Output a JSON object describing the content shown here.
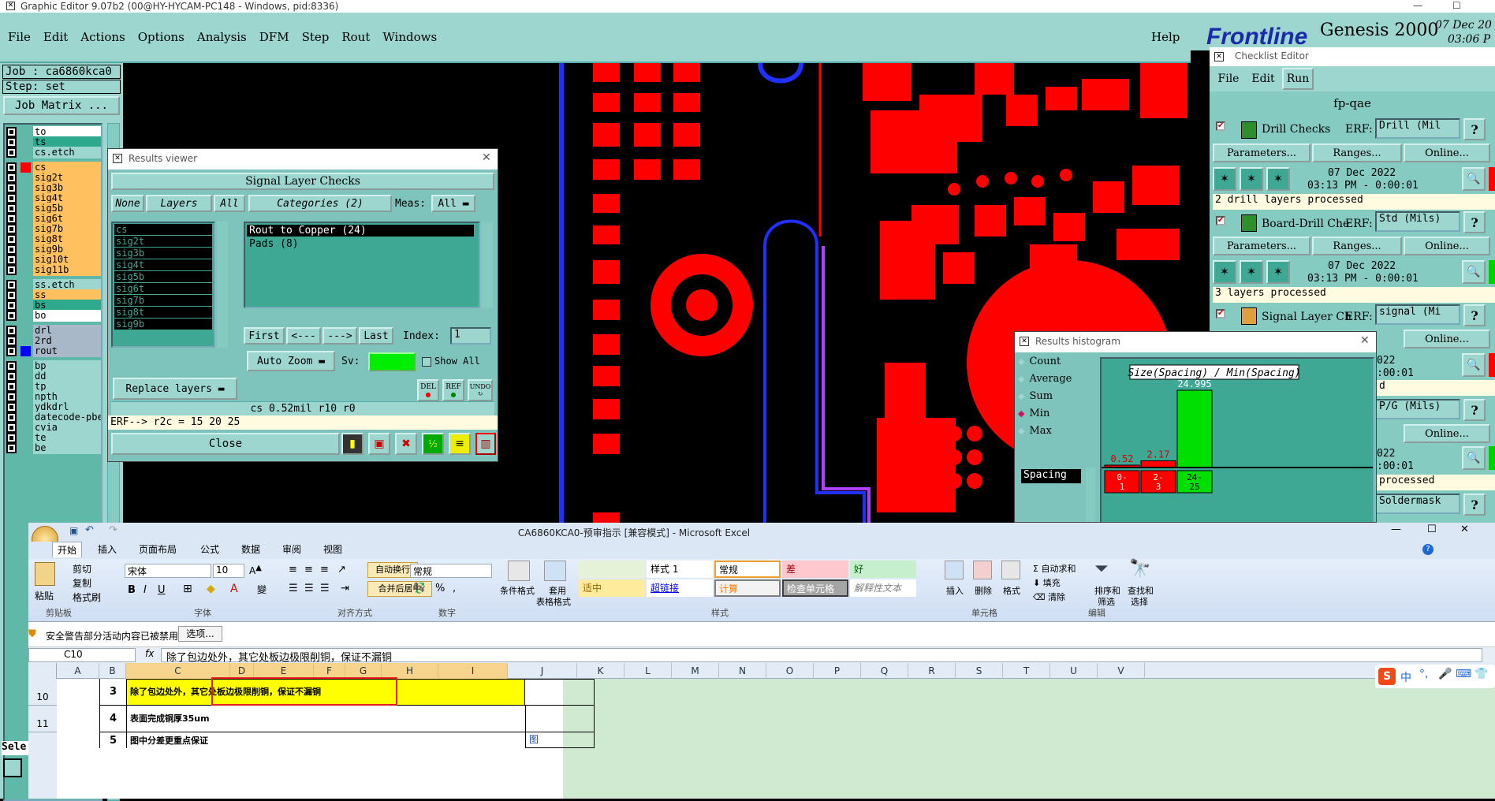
{
  "window_title": "Graphic Editor 9.07b2 (00@HY-HYCAM-PC148 - Windows, pid:8336)",
  "menu": [
    "File",
    "Edit",
    "Actions",
    "Options",
    "Analysis",
    "DFM",
    "Step",
    "Rout",
    "Windows"
  ],
  "menu_help": "Help",
  "brand": {
    "logo": "Frontline",
    "product": "Genesis 2000",
    "date": "07 Dec 20",
    "time": "03:06 P"
  },
  "job": {
    "job_label": "Job : ca6860kca0",
    "step_label": "Step: set",
    "matrix_button": "Job Matrix ..."
  },
  "layers": [
    {
      "name": "to",
      "color": "#ffffff"
    },
    {
      "name": "ts",
      "color": "#2ea98e"
    },
    {
      "name": "cs.etch",
      "color": "#9cd6cf"
    },
    {
      "name": "cs",
      "color": "#ffc060",
      "swatch": "#ff0000"
    },
    {
      "name": "sig2t",
      "color": "#ffc060"
    },
    {
      "name": "sig3b",
      "color": "#ffc060"
    },
    {
      "name": "sig4t",
      "color": "#ffc060"
    },
    {
      "name": "sig5b",
      "color": "#ffc060"
    },
    {
      "name": "sig6t",
      "color": "#ffc060"
    },
    {
      "name": "sig7b",
      "color": "#ffc060"
    },
    {
      "name": "sig8t",
      "color": "#ffc060"
    },
    {
      "name": "sig9b",
      "color": "#ffc060"
    },
    {
      "name": "sig10t",
      "color": "#ffc060"
    },
    {
      "name": "sig11b",
      "color": "#ffc060"
    },
    {
      "name": "ss.etch",
      "color": "#9cd6cf"
    },
    {
      "name": "ss",
      "color": "#ffc060"
    },
    {
      "name": "bs",
      "color": "#2ea98e"
    },
    {
      "name": "bo",
      "color": "#ffffff"
    },
    {
      "name": "drl",
      "color": "#a8b8c8"
    },
    {
      "name": "2rd",
      "color": "#a8b8c8"
    },
    {
      "name": "rout",
      "color": "#a8b8c8",
      "swatch": "#0000ff"
    },
    {
      "name": "bp",
      "color": "#9cd6cf"
    },
    {
      "name": "dd",
      "color": "#9cd6cf"
    },
    {
      "name": "tp",
      "color": "#9cd6cf"
    },
    {
      "name": "npth",
      "color": "#9cd6cf"
    },
    {
      "name": "ydkdrl",
      "color": "#9cd6cf"
    },
    {
      "name": "datecode-pbe",
      "color": "#9cd6cf"
    },
    {
      "name": "cvia",
      "color": "#9cd6cf"
    },
    {
      "name": "te",
      "color": "#9cd6cf"
    },
    {
      "name": "be",
      "color": "#9cd6cf"
    }
  ],
  "sel_label": "Sele",
  "results_viewer": {
    "title": "Results viewer",
    "header": "Signal Layer Checks",
    "none_btn": "None",
    "layers_btn": "Layers",
    "all_btn": "All",
    "categories_btn": "Categories (2)",
    "meas_label": "Meas:",
    "meas_value": "All",
    "layer_list": [
      "cs",
      "sig2t",
      "sig3b",
      "sig4t",
      "sig5b",
      "sig6t",
      "sig7b",
      "sig8t",
      "sig9b"
    ],
    "categories": [
      "Rout to Copper (24)",
      "Pads (8)"
    ],
    "first_btn": "First",
    "prev_btn": "<---",
    "next_btn": "--->",
    "last_btn": "Last",
    "index_label": "Index:",
    "index_value": "1",
    "zoom_btn": "Auto Zoom",
    "sv_label": "Sv:",
    "show_all_label": "Show All",
    "replace_btn": "Replace layers",
    "small_btns": [
      "DEL",
      "REF",
      "UNDO"
    ],
    "status": "cs 0.52mil  r10  r0",
    "erf_line": "ERF--> r2c = 15 20 25",
    "close_btn": "Close"
  },
  "checklist": {
    "title": "Checklist Editor",
    "menu": [
      "File",
      "Edit",
      "Run"
    ],
    "name": "fp-qae",
    "items": [
      {
        "name": "Drill Checks",
        "erf_label": "ERF:",
        "erf_value": "Drill (Mil",
        "params": "Parameters...",
        "ranges": "Ranges...",
        "online": "Online...",
        "date": "07 Dec 2022",
        "time": "03:13 PM - 0:00:01",
        "summary": "2 drill layers processed",
        "status_color": "#ff0000"
      },
      {
        "name": "Board-Drill Che",
        "erf_label": "ERF:",
        "erf_value": "Std (Mils)",
        "params": "Parameters...",
        "ranges": "Ranges...",
        "online": "Online...",
        "date": "07 Dec 2022",
        "time": "03:13 PM - 0:00:01",
        "summary": "3 layers processed",
        "status_color": "#00d000"
      },
      {
        "name": "Signal Layer Ch",
        "erf_label": "ERF:",
        "erf_value": "signal (Mi",
        "online": "Online...",
        "date": "022",
        "time": ":00:01",
        "summary": "d",
        "status_color": "#ff0000"
      },
      {
        "erf_value": "P/G (Mils)",
        "online": "Online...",
        "date": "022",
        "time": ":00:01",
        "summary": "processed",
        "status_color": "#00d000"
      },
      {
        "erf_value": "Soldermask"
      }
    ]
  },
  "histogram": {
    "title": "Results histogram",
    "modes": [
      "Count",
      "Average",
      "Sum",
      "Min",
      "Max"
    ],
    "selected_mode": "Min",
    "type_label": "Spacing",
    "chart_title": "Size(Spacing) / Min(Spacing)"
  },
  "chart_data": {
    "type": "bar",
    "title": "Size(Spacing) / Min(Spacing)",
    "categories": [
      "0-1",
      "2-3",
      "24-25"
    ],
    "values": [
      0.52,
      2.17,
      24.995
    ],
    "value_labels": [
      "0.52",
      "2.17",
      "24.995"
    ],
    "category_labels": [
      [
        "0-",
        "1"
      ],
      [
        "2-",
        "3"
      ],
      [
        "24-",
        "25"
      ]
    ],
    "bar_colors": [
      "#ff0000",
      "#ff0000",
      "#00e000"
    ],
    "ylim": [
      0,
      25
    ]
  },
  "excel": {
    "title": "CA6860KCA0-预审指示  [兼容模式] - Microsoft Excel",
    "tabs": [
      "开始",
      "插入",
      "页面布局",
      "公式",
      "数据",
      "审阅",
      "视图"
    ],
    "clipboard": {
      "paste": "粘贴",
      "cut": "剪切",
      "copy": "复制",
      "format_painter": "格式刷",
      "label": "剪贴板"
    },
    "font": {
      "name": "宋体",
      "size": "10",
      "label": "字体"
    },
    "align": {
      "wrap": "自动换行",
      "merge": "合并后居中",
      "label": "对齐方式"
    },
    "number": {
      "format": "常规",
      "label": "数字"
    },
    "styles_btns": {
      "cond": "条件格式",
      "table1": "套用",
      "table2": "表格格式",
      "label": "样式"
    },
    "styles": [
      {
        "text": "",
        "bg": "#e6f2d8"
      },
      {
        "text": "样式 1",
        "bg": "#ffffff",
        "color": "#000"
      },
      {
        "text": "常规",
        "bg": "#ffffff",
        "color": "#000",
        "border": "#f0a030"
      },
      {
        "text": "差",
        "bg": "#ffc7ce",
        "color": "#9c0006"
      },
      {
        "text": "好",
        "bg": "#c6efce",
        "color": "#006100"
      },
      {
        "text": "适中",
        "bg": "#ffeb9c",
        "color": "#9c6500"
      },
      {
        "text": "超链接",
        "bg": "#ffffff",
        "color": "#0000ff",
        "underline": true
      },
      {
        "text": "计算",
        "bg": "#f2f2f2",
        "color": "#fa7d00",
        "border": "#7f7f7f"
      },
      {
        "text": "检查单元格",
        "bg": "#a5a5a5",
        "color": "#ffffff",
        "border": "#3f3f3f"
      },
      {
        "text": "解释性文本",
        "bg": "#ffffff",
        "color": "#7f7f7f",
        "italic": true
      }
    ],
    "cells_group": {
      "insert": "插入",
      "delete": "删除",
      "format": "格式",
      "label": "单元格"
    },
    "edit_group": {
      "autosum": "自动求和",
      "fill": "填充",
      "clear": "清除",
      "sort": "排序和",
      "sort2": "筛选",
      "find": "查找和",
      "find2": "选择",
      "label": "编辑"
    },
    "security": {
      "warning": "安全警告",
      "message": "部分活动内容已被禁用。",
      "options": "选项..."
    },
    "namebox": "C10",
    "formula": "除了包边处外，其它处板边极限削铜，保证不漏铜",
    "columns": [
      "A",
      "B",
      "C",
      "D",
      "E",
      "F",
      "G",
      "H",
      "I",
      "J",
      "K",
      "L",
      "M",
      "N",
      "O",
      "P",
      "Q",
      "R",
      "S",
      "T",
      "U",
      "V"
    ],
    "rows": [
      {
        "num": "10",
        "b": "3",
        "c": "除了包边处外，其它处板边极限削铜，保证不漏铜"
      },
      {
        "num": "11",
        "b": "4",
        "c": "表面完成铜厚35um"
      },
      {
        "num": "",
        "b": "5",
        "c": "图中分差更重点保证",
        "j": "图"
      }
    ],
    "ime": "中"
  }
}
